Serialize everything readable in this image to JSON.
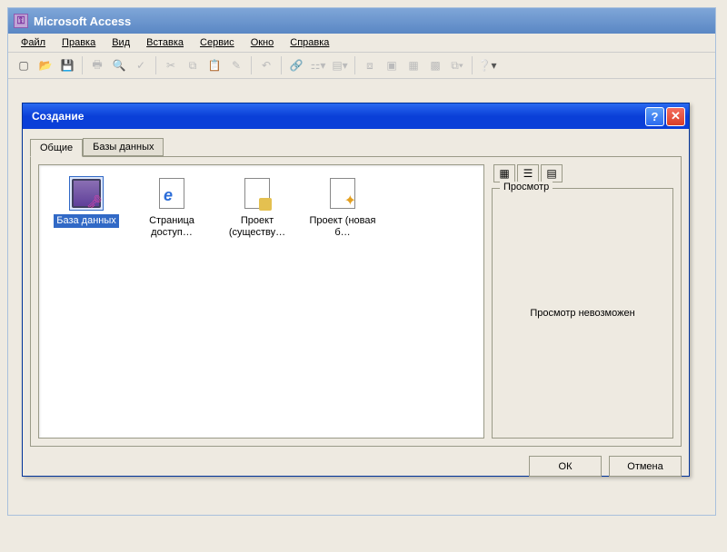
{
  "app": {
    "title": "Microsoft Access"
  },
  "menubar": {
    "file": "Файл",
    "edit": "Правка",
    "view": "Вид",
    "insert": "Вставка",
    "service": "Сервис",
    "window": "Окно",
    "help": "Справка"
  },
  "dialog": {
    "title": "Создание",
    "tabs": {
      "general": "Общие",
      "databases": "Базы данных"
    },
    "items": [
      {
        "id": "database",
        "label": "База данных",
        "selected": true
      },
      {
        "id": "access-page",
        "label": "Страница доступ…",
        "selected": false
      },
      {
        "id": "project-existing",
        "label": "Проект (существу…",
        "selected": false
      },
      {
        "id": "project-new",
        "label": "Проект (новая б…",
        "selected": false
      }
    ],
    "preview": {
      "legend": "Просмотр",
      "message": "Просмотр невозможен"
    },
    "buttons": {
      "ok": "ОК",
      "cancel": "Отмена"
    }
  }
}
